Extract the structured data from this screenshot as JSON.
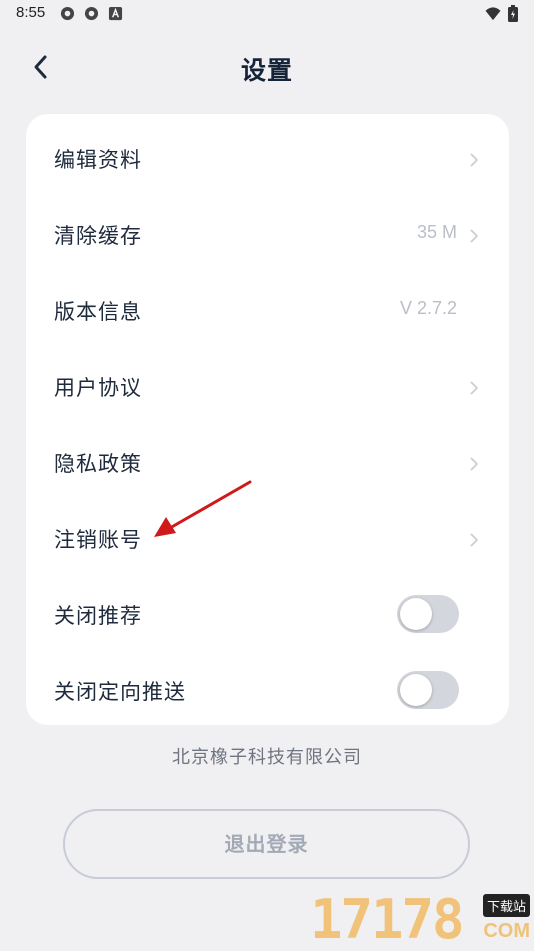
{
  "status_bar": {
    "time": "8:55"
  },
  "header": {
    "title": "设置"
  },
  "settings": {
    "items": [
      {
        "label": "编辑资料",
        "value": "",
        "chevron": true
      },
      {
        "label": "清除缓存",
        "value": "35 M",
        "chevron": true
      },
      {
        "label": "版本信息",
        "value": "V 2.7.2",
        "chevron": false
      },
      {
        "label": "用户协议",
        "value": "",
        "chevron": true
      },
      {
        "label": "隐私政策",
        "value": "",
        "chevron": true
      },
      {
        "label": "注销账号",
        "value": "",
        "chevron": true
      }
    ],
    "toggles": [
      {
        "label": "关闭推荐",
        "on": false
      },
      {
        "label": "关闭定向推送",
        "on": false
      }
    ]
  },
  "company": "北京橡子科技有限公司",
  "logout_label": "退出登录",
  "watermark": {
    "number": "17178",
    "badge": "下载站",
    "suffix": "COM"
  },
  "colors": {
    "background": "#f0f0f2",
    "card": "#ffffff",
    "title": "#16243a",
    "annotation_arrow": "#d0191b"
  }
}
